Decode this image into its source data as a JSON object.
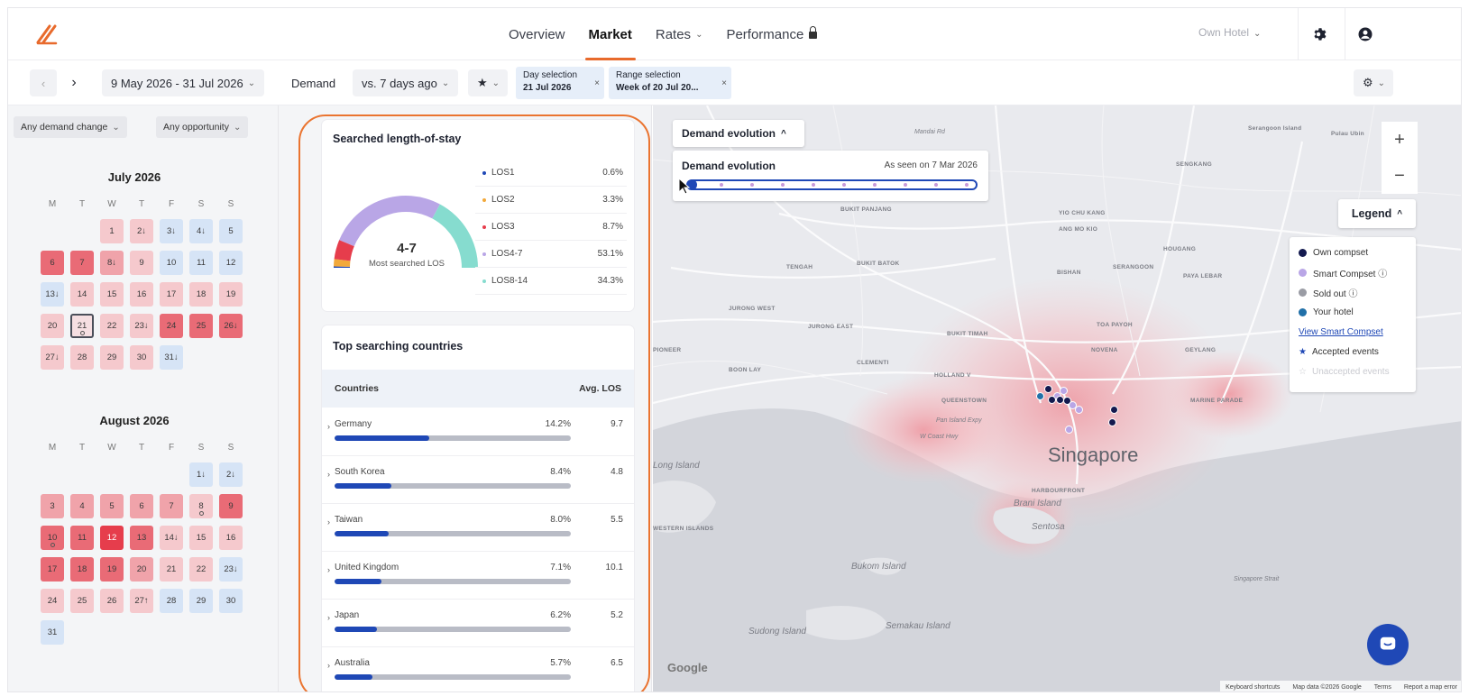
{
  "nav": {
    "tabs": [
      {
        "label": "Overview"
      },
      {
        "label": "Market"
      },
      {
        "label": "Rates"
      },
      {
        "label": "Performance"
      }
    ],
    "hotel_select": "Own Hotel",
    "accent_color": "#e86a2c"
  },
  "toolbar": {
    "date_range": "9 May 2026 - 31 Jul 2026",
    "demand_label": "Demand",
    "compare": "vs. 7 days ago",
    "star_icon": "star-icon",
    "day_selection": {
      "title": "Day selection",
      "value": "21 Jul 2026"
    },
    "range_selection": {
      "title": "Range selection",
      "value": "Week of 20 Jul 20..."
    }
  },
  "filters": {
    "demand_change": "Any demand change",
    "opportunity": "Any opportunity"
  },
  "weekdays": [
    "M",
    "T",
    "W",
    "T",
    "F",
    "S",
    "S"
  ],
  "calendars": [
    {
      "title": "July 2026",
      "days": [
        {
          "t": "",
          "c": "e"
        },
        {
          "t": "",
          "c": "e"
        },
        {
          "t": "1",
          "c": "c1"
        },
        {
          "t": "2↓",
          "c": "c1"
        },
        {
          "t": "3↓",
          "c": "bl"
        },
        {
          "t": "4↓",
          "c": "bl"
        },
        {
          "t": "5",
          "c": "bl"
        },
        {
          "t": "6",
          "c": "c3"
        },
        {
          "t": "7",
          "c": "c3"
        },
        {
          "t": "8↓",
          "c": "c2"
        },
        {
          "t": "9",
          "c": "c1"
        },
        {
          "t": "10",
          "c": "bl"
        },
        {
          "t": "11",
          "c": "bl"
        },
        {
          "t": "12",
          "c": "bl"
        },
        {
          "t": "13↓",
          "c": "bl"
        },
        {
          "t": "14",
          "c": "c1"
        },
        {
          "t": "15",
          "c": "c1"
        },
        {
          "t": "16",
          "c": "c1"
        },
        {
          "t": "17",
          "c": "c1"
        },
        {
          "t": "18",
          "c": "c1"
        },
        {
          "t": "19",
          "c": "c1"
        },
        {
          "t": "20",
          "c": "c1"
        },
        {
          "t": "21",
          "c": "sel",
          "dot": true
        },
        {
          "t": "22",
          "c": "c1"
        },
        {
          "t": "23↓",
          "c": "c1"
        },
        {
          "t": "24",
          "c": "c3"
        },
        {
          "t": "25",
          "c": "c3"
        },
        {
          "t": "26↓",
          "c": "c3"
        },
        {
          "t": "27↓",
          "c": "c1"
        },
        {
          "t": "28",
          "c": "c1"
        },
        {
          "t": "29",
          "c": "c1"
        },
        {
          "t": "30",
          "c": "c1"
        },
        {
          "t": "31↓",
          "c": "bl"
        }
      ]
    },
    {
      "title": "August 2026",
      "days": [
        {
          "t": "",
          "c": "e"
        },
        {
          "t": "",
          "c": "e"
        },
        {
          "t": "",
          "c": "e"
        },
        {
          "t": "",
          "c": "e"
        },
        {
          "t": "",
          "c": "e"
        },
        {
          "t": "1↓",
          "c": "bl"
        },
        {
          "t": "2↓",
          "c": "bl"
        },
        {
          "t": "3",
          "c": "c2"
        },
        {
          "t": "4",
          "c": "c2"
        },
        {
          "t": "5",
          "c": "c2"
        },
        {
          "t": "6",
          "c": "c2"
        },
        {
          "t": "7",
          "c": "c2"
        },
        {
          "t": "8",
          "c": "c1",
          "dot": true
        },
        {
          "t": "9",
          "c": "c3"
        },
        {
          "t": "10",
          "c": "c3",
          "dot": true
        },
        {
          "t": "11",
          "c": "c3"
        },
        {
          "t": "12",
          "c": "c4"
        },
        {
          "t": "13",
          "c": "c3"
        },
        {
          "t": "14↓",
          "c": "c1"
        },
        {
          "t": "15",
          "c": "c1"
        },
        {
          "t": "16",
          "c": "c1"
        },
        {
          "t": "17",
          "c": "c3"
        },
        {
          "t": "18",
          "c": "c3"
        },
        {
          "t": "19",
          "c": "c3"
        },
        {
          "t": "20",
          "c": "c2"
        },
        {
          "t": "21",
          "c": "c1"
        },
        {
          "t": "22",
          "c": "c1"
        },
        {
          "t": "23↓",
          "c": "bl"
        },
        {
          "t": "24",
          "c": "c1"
        },
        {
          "t": "25",
          "c": "c1"
        },
        {
          "t": "26",
          "c": "c1"
        },
        {
          "t": "27↑",
          "c": "c1"
        },
        {
          "t": "28",
          "c": "bl"
        },
        {
          "t": "29",
          "c": "bl"
        },
        {
          "t": "30",
          "c": "bl"
        },
        {
          "t": "31",
          "c": "bl"
        }
      ]
    }
  ],
  "los": {
    "title": "Searched length-of-stay",
    "center_value": "4-7",
    "center_label": "Most searched LOS",
    "rows": [
      {
        "label": "LOS1",
        "pct": "0.6%",
        "value": 0.6,
        "color": "#1f48b6"
      },
      {
        "label": "LOS2",
        "pct": "3.3%",
        "value": 3.3,
        "color": "#f2a93b"
      },
      {
        "label": "LOS3",
        "pct": "8.7%",
        "value": 8.7,
        "color": "#e63d4c"
      },
      {
        "label": "LOS4-7",
        "pct": "53.1%",
        "value": 53.1,
        "color": "#b9a6e6"
      },
      {
        "label": "LOS8-14",
        "pct": "34.3%",
        "value": 34.3,
        "color": "#86dccf"
      }
    ]
  },
  "countries": {
    "title": "Top searching countries",
    "col_country": "Countries",
    "col_los": "Avg. LOS",
    "rows": [
      {
        "name": "Germany",
        "pct": "14.2%",
        "los": "9.7",
        "share": 0.4
      },
      {
        "name": "South Korea",
        "pct": "8.4%",
        "los": "4.8",
        "share": 0.24
      },
      {
        "name": "Taiwan",
        "pct": "8.0%",
        "los": "5.5",
        "share": 0.23
      },
      {
        "name": "United Kingdom",
        "pct": "7.1%",
        "los": "10.1",
        "share": 0.2
      },
      {
        "name": "Japan",
        "pct": "6.2%",
        "los": "5.2",
        "share": 0.18
      },
      {
        "name": "Australia",
        "pct": "5.7%",
        "los": "6.5",
        "share": 0.16
      }
    ]
  },
  "map": {
    "demand_evolution_button": "Demand evolution",
    "demand_panel_title": "Demand evolution",
    "demand_panel_date": "As seen on 7 Mar 2026",
    "legend_title": "Legend",
    "legend": [
      {
        "label": "Own compset",
        "color": "#141a4f"
      },
      {
        "label": "Smart Compset ⓘ",
        "color": "#b9a6e6"
      },
      {
        "label": "Sold out ⓘ",
        "color": "#9a9ca4"
      },
      {
        "label": "Your hotel",
        "color": "#2170a8"
      }
    ],
    "legend_link": "View Smart Compset",
    "legend_accepted": "Accepted events",
    "legend_unaccepted": "Unaccepted events",
    "zoom_in": "+",
    "zoom_out": "−",
    "city": "Singapore",
    "google": "Google",
    "attribution": [
      "Keyboard shortcuts",
      "Map data ©2026 Google",
      "Terms",
      "Report a map error"
    ],
    "areas": [
      "Serangoon Island",
      "Pulau Ubin",
      "SENGKANG",
      "BUKIT PANJANG",
      "YIO CHU KANG",
      "ANG MO KIO",
      "HOUGANG",
      "TENGAH",
      "BUKIT BATOK",
      "BISHAN",
      "SERANGOON",
      "PAYA LEBAR",
      "JURONG WEST",
      "JURONG EAST",
      "BUKIT TIMAH",
      "TOA PAYOH",
      "PIONEER",
      "BOON LAY",
      "CLEMENTI",
      "HOLLAND V",
      "NOVENA",
      "GEYLANG",
      "QUEENSTOWN",
      "MARINE PARADE",
      "HARBOURFRONT",
      "WESTERN ISLANDS"
    ],
    "islands": [
      "Long Island",
      "Brani Island",
      "Sentosa",
      "Bukom Island",
      "Sudong Island",
      "Semakau Island",
      "Singapore Strait",
      "Mandai Rd",
      "Pan Island Expy",
      "W Coast Hwy"
    ]
  }
}
